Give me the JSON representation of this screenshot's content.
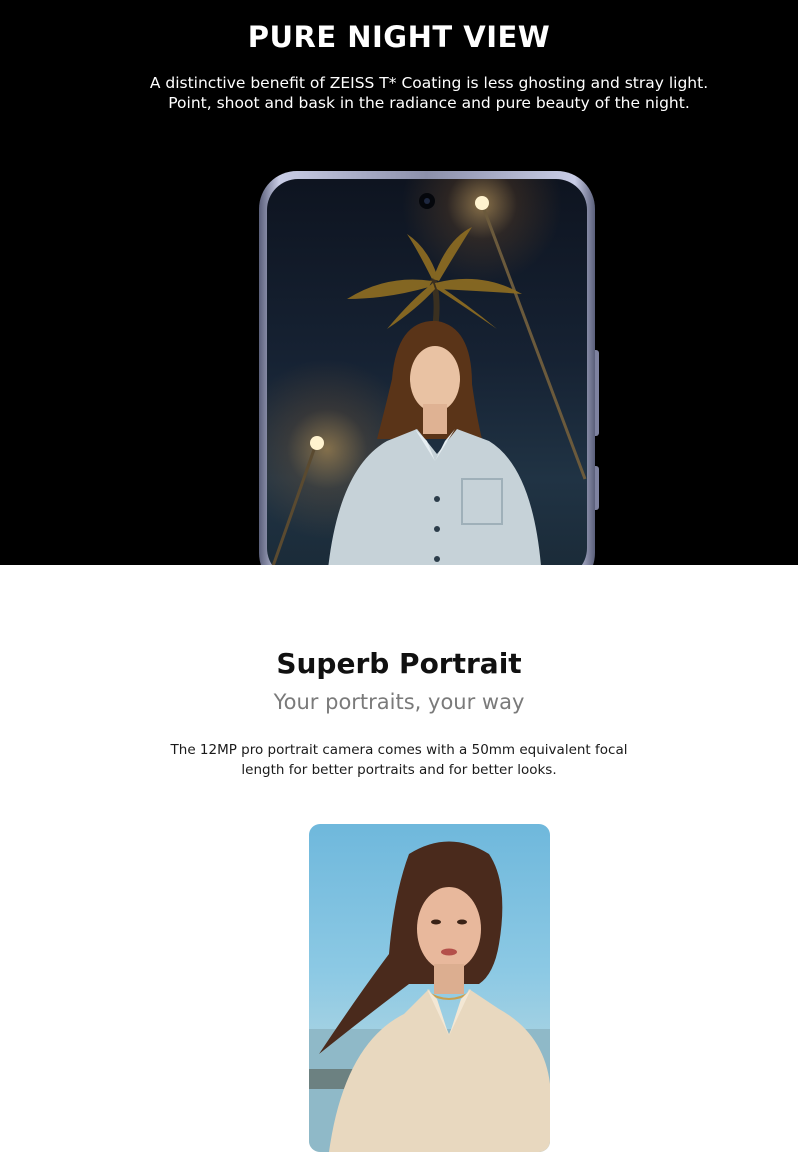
{
  "night_view": {
    "title": "PURE NIGHT VIEW",
    "description": "A distinctive benefit of ZEISS T* Coating is less ghosting and stray light. Point, shoot and bask in the radiance and pure beauty of the night."
  },
  "portrait": {
    "title": "Superb Portrait",
    "subtitle": "Your portraits, your way",
    "description": "The 12MP pro portrait camera comes with a 50mm equivalent focal length for better portraits and for better looks."
  },
  "colors": {
    "night_background": "#000000",
    "portrait_background": "#ffffff",
    "subtitle_gray": "#7a7a7a"
  }
}
